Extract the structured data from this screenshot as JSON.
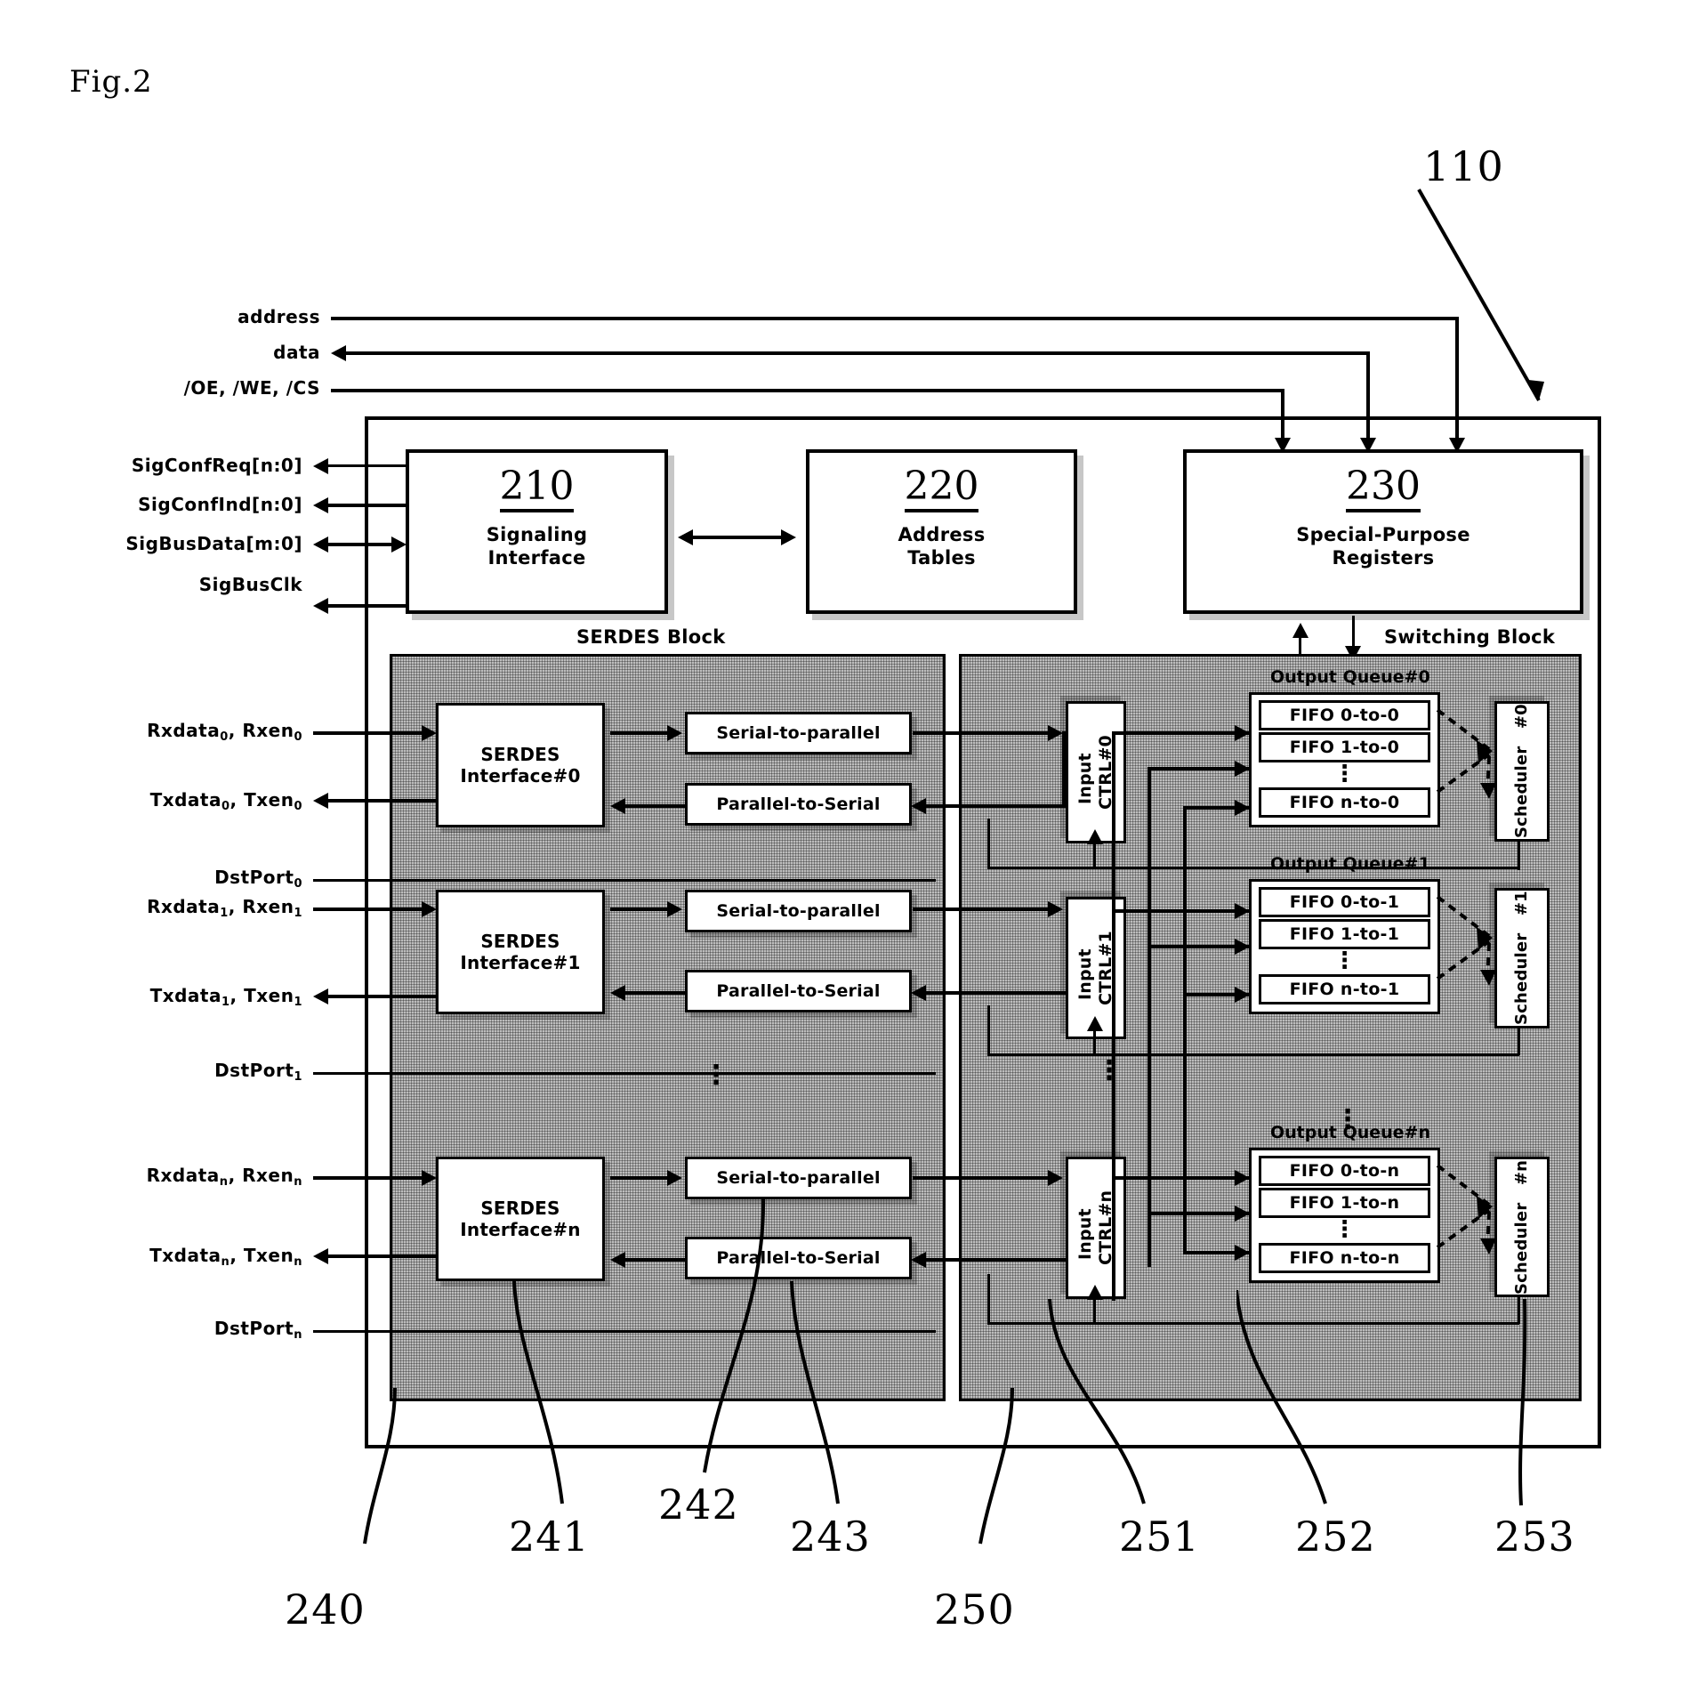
{
  "figure": {
    "label": "Fig.2"
  },
  "reference_numerals": {
    "chip": "110",
    "signaling_interface": "210",
    "address_tables": "220",
    "special_purpose_registers": "230",
    "serdes_block": "240",
    "serdes_interface": "241",
    "serial_to_parallel": "242",
    "parallel_to_serial": "243",
    "switching_block": "250",
    "input_ctrl": "251",
    "output_queue": "252",
    "scheduler": "253"
  },
  "top_signals": [
    {
      "name": "address",
      "direction": "in"
    },
    {
      "name": "data",
      "direction": "bidir"
    },
    {
      "name": "/OE, /WE, /CS",
      "direction": "in"
    }
  ],
  "signaling_signals": [
    {
      "name": "SigConfReq[n:0]",
      "direction": "out"
    },
    {
      "name": "SigConfInd[n:0]",
      "direction": "out"
    },
    {
      "name": "SigBusData[m:0]",
      "direction": "bidir"
    },
    {
      "name": "SigBusClk",
      "direction": "out"
    }
  ],
  "top_blocks": [
    {
      "num": "210",
      "line1": "Signaling",
      "line2": "Interface"
    },
    {
      "num": "220",
      "line1": "Address",
      "line2": "Tables"
    },
    {
      "num": "230",
      "line1": "Special-Purpose",
      "line2": "Registers"
    }
  ],
  "block_captions": {
    "serdes": "SERDES Block",
    "switching": "Switching Block"
  },
  "ports": [
    {
      "index": "0",
      "rx": "Rxdata",
      "rx_en": "Rxen",
      "rx_sub": "0",
      "tx": "Txdata",
      "tx_en": "Txen",
      "tx_sub": "0",
      "dstport": "DstPort",
      "dstport_sub": "0",
      "serdes_if_l1": "SERDES",
      "serdes_if_l2": "Interface#0",
      "stp": "Serial-to-parallel",
      "pts": "Parallel-to-Serial",
      "input_ctrl_l1": "Input",
      "input_ctrl_l2": "CTRL#0",
      "oq_title": "Output Queue#0",
      "fifos": [
        "FIFO 0-to-0",
        "FIFO 1-to-0",
        "FIFO n-to-0"
      ],
      "scheduler_l1": "Scheduler",
      "scheduler_l2": "#0"
    },
    {
      "index": "1",
      "rx": "Rxdata",
      "rx_en": "Rxen",
      "rx_sub": "1",
      "tx": "Txdata",
      "tx_en": "Txen",
      "tx_sub": "1",
      "dstport": "DstPort",
      "dstport_sub": "1",
      "serdes_if_l1": "SERDES",
      "serdes_if_l2": "Interface#1",
      "stp": "Serial-to-parallel",
      "pts": "Parallel-to-Serial",
      "input_ctrl_l1": "Input",
      "input_ctrl_l2": "CTRL#1",
      "oq_title": "Output Queue#1",
      "fifos": [
        "FIFO 0-to-1",
        "FIFO 1-to-1",
        "FIFO n-to-1"
      ],
      "scheduler_l1": "Scheduler",
      "scheduler_l2": "#1"
    },
    {
      "index": "n",
      "rx": "Rxdata",
      "rx_en": "Rxen",
      "rx_sub": "n",
      "tx": "Txdata",
      "tx_en": "Txen",
      "tx_sub": "n",
      "dstport": "DstPort",
      "dstport_sub": "n",
      "serdes_if_l1": "SERDES",
      "serdes_if_l2": "Interface#n",
      "stp": "Serial-to-parallel",
      "pts": "Parallel-to-Serial",
      "input_ctrl_l1": "Input",
      "input_ctrl_l2": "CTRL#n",
      "oq_title": "Output Queue#n",
      "fifos": [
        "FIFO 0-to-n",
        "FIFO 1-to-n",
        "FIFO n-to-n"
      ],
      "scheduler_l1": "Scheduler",
      "scheduler_l2": "#n"
    }
  ],
  "ellipsis": {
    "vertical": "⋮"
  },
  "colors": {
    "ink": "#000000",
    "paper": "#ffffff",
    "shaded_block": "#bdbdbd"
  }
}
